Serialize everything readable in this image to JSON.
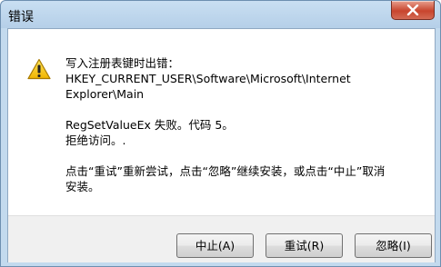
{
  "window": {
    "title": "错误"
  },
  "dialog": {
    "line1": "写入注册表键时出错：",
    "line2": "HKEY_CURRENT_USER\\Software\\Microsoft\\Internet",
    "line3": "Explorer\\Main",
    "line4": "RegSetValueEx 失败。代码 5。",
    "line5": "拒绝访问。.",
    "line6": "点击“重试”重新尝试，点击“忽略”继续安装，或点击“中止”取消",
    "line7": "安装。"
  },
  "buttons": {
    "abort": "中止(A)",
    "retry": "重试(R)",
    "ignore": "忽略(I)"
  },
  "icons": {
    "warning": "warning-icon",
    "close": "close-icon"
  },
  "colors": {
    "warning_fill": "#f5c400",
    "close_button": "#c8452e"
  }
}
